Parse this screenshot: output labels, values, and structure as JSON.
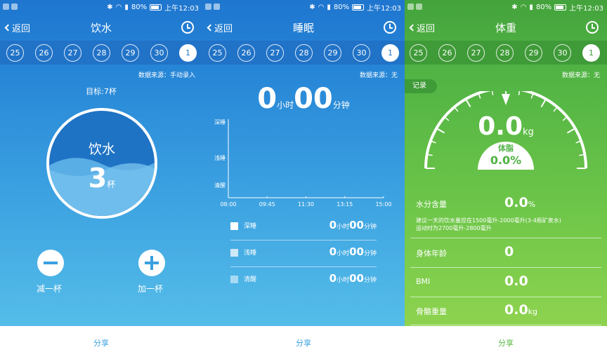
{
  "status_bar": {
    "battery": "80%",
    "time": "上午12:03"
  },
  "back_label": "返回",
  "dates": [
    "25",
    "26",
    "27",
    "28",
    "29",
    "30",
    "1"
  ],
  "share_label": "分享",
  "water": {
    "title": "饮水",
    "data_source": "数据来源：手动录入",
    "goal": "目标:7杯",
    "circle_title": "饮水",
    "count": "3",
    "count_unit": "杯",
    "minus_label": "减一杯",
    "plus_label": "加一杯",
    "accent": "#3aa0e0"
  },
  "sleep": {
    "title": "睡眠",
    "data_source": "数据来源：无",
    "total": {
      "hours": "0",
      "hours_unit": "小时",
      "minutes": "00",
      "minutes_unit": "分钟"
    },
    "chart_data": {
      "type": "bar",
      "title": "",
      "y_categories": [
        "深睡",
        "浅睡",
        "清醒"
      ],
      "x_ticks": [
        "08:00",
        "09:45",
        "11:30",
        "13:15",
        "15:00"
      ],
      "series": [],
      "grid": false
    },
    "legend": [
      {
        "name": "深睡",
        "hours": "0",
        "hours_unit": "小时",
        "minutes": "00",
        "minutes_unit": "分钟",
        "color": "#ffffff"
      },
      {
        "name": "浅睡",
        "hours": "0",
        "hours_unit": "小时",
        "minutes": "00",
        "minutes_unit": "分钟",
        "color": "#cfe8f8"
      },
      {
        "name": "清醒",
        "hours": "0",
        "hours_unit": "小时",
        "minutes": "00",
        "minutes_unit": "分钟",
        "color": "#a7d9f3"
      }
    ]
  },
  "weight": {
    "title": "体重",
    "data_source": "数据来源：无",
    "record_tag": "记录",
    "value": "0.0",
    "unit": "kg",
    "fat_label": "体脂",
    "fat_value": "0.0%",
    "metrics": [
      {
        "name": "水分含量",
        "value": "0.0",
        "unit": "%"
      },
      {
        "name": "身体年龄",
        "value": "0",
        "unit": ""
      },
      {
        "name": "BMI",
        "value": "0.0",
        "unit": ""
      },
      {
        "name": "骨骼重量",
        "value": "0.0",
        "unit": "kg"
      }
    ],
    "advice_line1": "建议一天的饮水量应在1500毫升-2000毫升(3-4瓶矿泉水)",
    "advice_line2": "运动时为2700毫升-2800毫升",
    "accent": "#59b840"
  }
}
